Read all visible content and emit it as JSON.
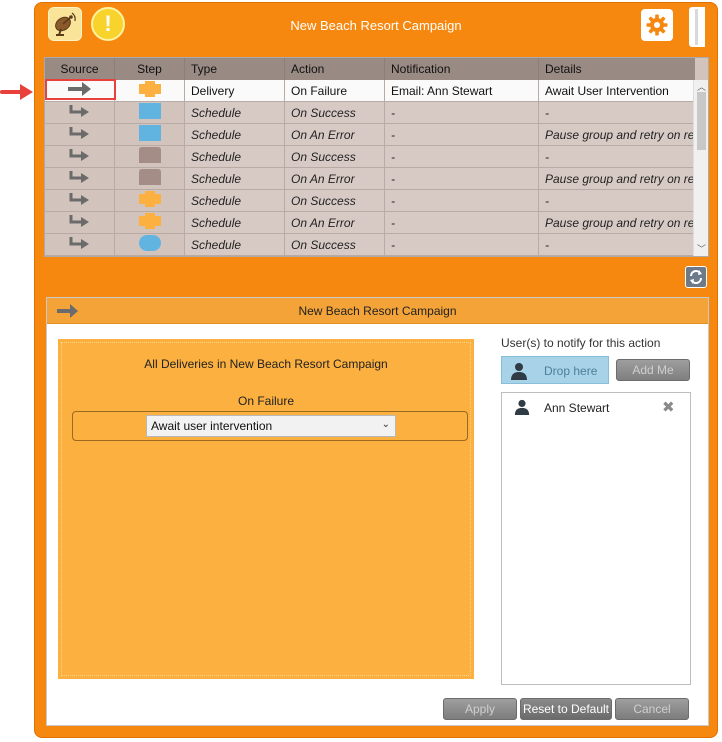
{
  "header": {
    "title": "New Beach Resort Campaign",
    "warning_glyph": "!",
    "icons": {
      "source": "satellite-dish-icon",
      "warning": "warning-icon",
      "settings": "gear-icon"
    }
  },
  "table": {
    "columns": [
      "Source",
      "Step",
      "Type",
      "Action",
      "Notification",
      "Details"
    ],
    "rows": [
      {
        "step_shape": "cross",
        "step_color": "#fbb040",
        "type": "Delivery",
        "action": "On Failure",
        "notification": "Email: Ann Stewart",
        "details": "Await User Intervention"
      },
      {
        "step_shape": "square",
        "step_color": "#62b4e0",
        "type": "Schedule",
        "action": "On Success",
        "notification": "-",
        "details": "-"
      },
      {
        "step_shape": "square",
        "step_color": "#62b4e0",
        "type": "Schedule",
        "action": "On An Error",
        "notification": "-",
        "details": "Pause group and retry on res"
      },
      {
        "step_shape": "tab",
        "step_color": "#a48d86",
        "type": "Schedule",
        "action": "On Success",
        "notification": "-",
        "details": "-"
      },
      {
        "step_shape": "tab",
        "step_color": "#a48d86",
        "type": "Schedule",
        "action": "On An Error",
        "notification": "-",
        "details": "Pause group and retry on res"
      },
      {
        "step_shape": "cross",
        "step_color": "#fbb040",
        "type": "Schedule",
        "action": "On Success",
        "notification": "-",
        "details": "-"
      },
      {
        "step_shape": "cross",
        "step_color": "#fbb040",
        "type": "Schedule",
        "action": "On An Error",
        "notification": "-",
        "details": "Pause group and retry on res"
      },
      {
        "step_shape": "pill",
        "step_color": "#62b4e0",
        "type": "Schedule",
        "action": "On Success",
        "notification": "-",
        "details": "-"
      }
    ]
  },
  "detail": {
    "title": "New Beach Resort Campaign",
    "card_title": "All Deliveries in New Beach Resort Campaign",
    "condition_label": "On Failure",
    "select_value": "Await user intervention"
  },
  "notify": {
    "label": "User(s) to notify for this action",
    "drop_label": "Drop here",
    "add_me_label": "Add Me",
    "users": [
      "Ann Stewart"
    ],
    "remove_glyph": "✖"
  },
  "buttons": {
    "apply": "Apply",
    "reset": "Reset to Default",
    "cancel": "Cancel"
  },
  "colors": {
    "window_orange": "#f7880f",
    "panel_header": "#f3a338",
    "card_orange": "#fbb040",
    "highlight_red": "#e8413c"
  }
}
